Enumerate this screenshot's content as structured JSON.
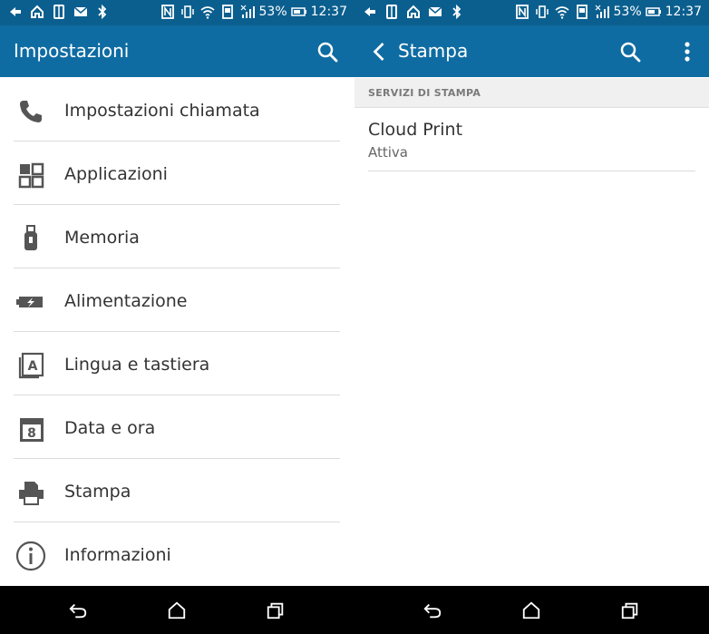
{
  "colors": {
    "statusbar": "#0b5f8f",
    "appbar": "#0f6ca2",
    "icon_gray": "#555555",
    "navbar": "#000000"
  },
  "statusbar": {
    "left_icons": [
      "back-arrow-icon",
      "home-icon",
      "phone-device-icon",
      "mail-icon",
      "bluetooth-icon"
    ],
    "right_icons": [
      "nfc-icon",
      "vibrate-icon",
      "wifi-icon",
      "data-saver-icon",
      "signal-icon"
    ],
    "battery_percent": "53%",
    "battery_icon": "battery-icon",
    "time": "12:37"
  },
  "left": {
    "appbar": {
      "title": "Impostazioni",
      "search_icon": "search-icon"
    },
    "items": [
      {
        "label": "Impostazioni chiamata",
        "icon": "phone-icon"
      },
      {
        "label": "Applicazioni",
        "icon": "apps-grid-icon"
      },
      {
        "label": "Memoria",
        "icon": "usb-storage-icon"
      },
      {
        "label": "Alimentazione",
        "icon": "battery-charging-icon"
      },
      {
        "label": "Lingua e tastiera",
        "icon": "keyboard-language-icon"
      },
      {
        "label": "Data e ora",
        "icon": "calendar-icon"
      },
      {
        "label": "Stampa",
        "icon": "printer-icon"
      },
      {
        "label": "Informazioni",
        "icon": "info-icon"
      }
    ]
  },
  "right": {
    "appbar": {
      "title": "Stampa",
      "back_icon": "chevron-left-icon",
      "search_icon": "search-icon",
      "menu_icon": "more-vert-icon"
    },
    "section_header": "SERVIZI DI STAMPA",
    "service": {
      "title": "Cloud Print",
      "status": "Attiva"
    }
  },
  "navbar": {
    "buttons": [
      "back-nav-icon",
      "home-nav-icon",
      "recents-nav-icon"
    ]
  }
}
